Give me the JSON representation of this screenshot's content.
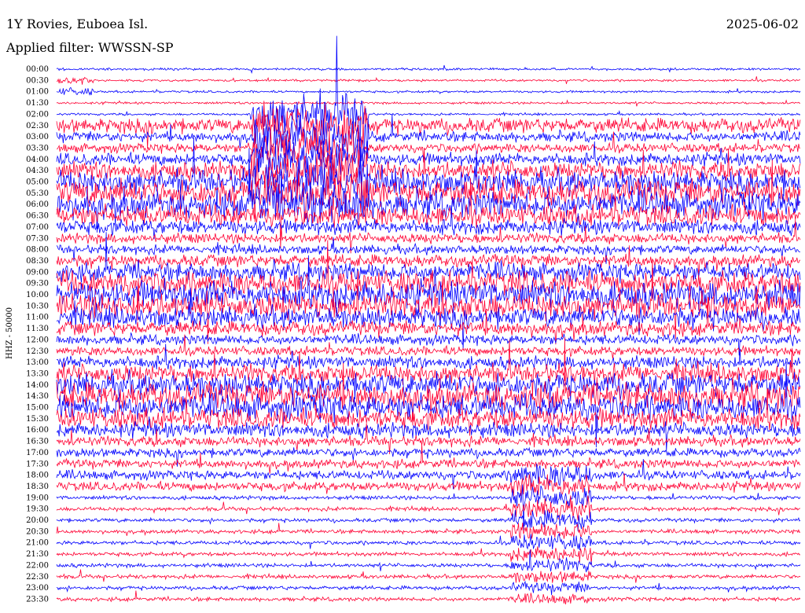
{
  "header": {
    "station": "1Y Rovies, Euboea Isl.",
    "filter": "Applied filter: WWSSN-SP",
    "date": "2025-06-02"
  },
  "chart_data": {
    "type": "helicorder",
    "ylabel": "HHZ - 50000",
    "row_labels": [
      "00:00",
      "00:30",
      "01:00",
      "01:30",
      "02:00",
      "02:30",
      "03:00",
      "03:30",
      "04:00",
      "04:30",
      "05:00",
      "05:30",
      "06:00",
      "06:30",
      "07:00",
      "07:30",
      "08:00",
      "08:30",
      "09:00",
      "09:30",
      "10:00",
      "10:30",
      "11:00",
      "11:30",
      "12:00",
      "12:30",
      "13:00",
      "13:30",
      "14:00",
      "14:30",
      "15:00",
      "15:30",
      "16:00",
      "16:30",
      "17:00",
      "17:30",
      "18:00",
      "18:30",
      "19:00",
      "19:30",
      "20:00",
      "20:30",
      "21:00",
      "21:30",
      "22:00",
      "22:30",
      "23:00",
      "23:30"
    ],
    "row_duration_min": 30,
    "colors": [
      "#0000ff",
      "#ff0033"
    ]
  }
}
